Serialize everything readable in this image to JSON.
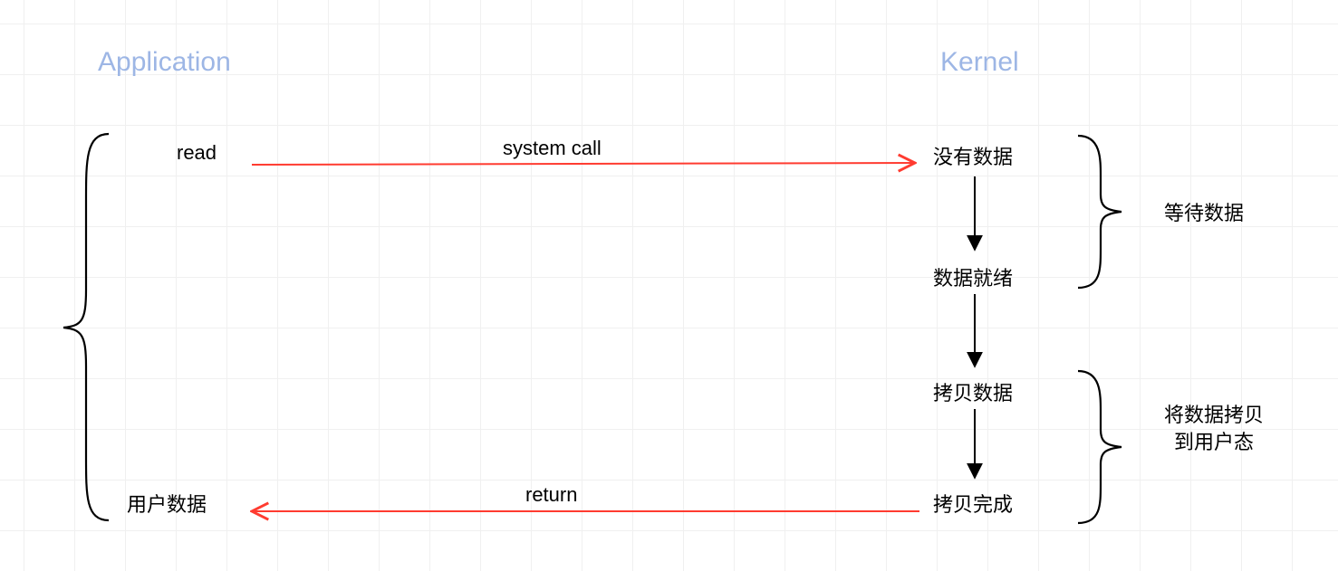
{
  "headers": {
    "application": "Application",
    "kernel": "Kernel"
  },
  "nodes": {
    "read": "read",
    "user_data": "用户数据",
    "no_data": "没有数据",
    "data_ready": "数据就绪",
    "copy_data": "拷贝数据",
    "copy_done": "拷贝完成"
  },
  "arrows": {
    "system_call": "system call",
    "return": "return"
  },
  "side_labels": {
    "wait_data": "等待数据",
    "copy_to_user": "将数据拷贝到用户态"
  }
}
